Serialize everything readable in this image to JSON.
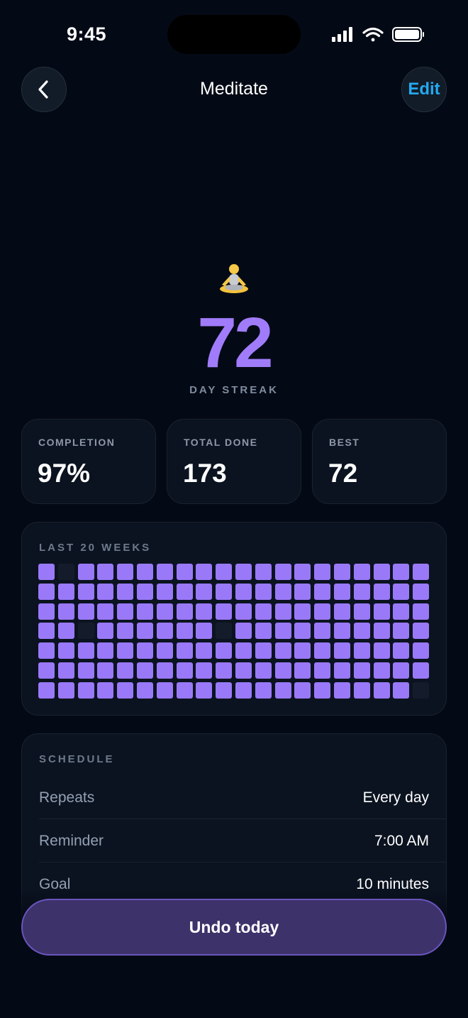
{
  "status_bar": {
    "time": "9:45"
  },
  "header": {
    "title": "Meditate",
    "edit_label": "Edit"
  },
  "habit": {
    "emoji": "person-in-lotus-position",
    "streak_value": "72",
    "streak_label": "DAY STREAK"
  },
  "stats": [
    {
      "label": "COMPLETION",
      "value": "97%"
    },
    {
      "label": "TOTAL DONE",
      "value": "173"
    },
    {
      "label": "BEST",
      "value": "72"
    }
  ],
  "history": {
    "title": "LAST 20 WEEKS",
    "done_color": "#9a79f9",
    "missed_color": "#141c2c",
    "missed_cells": [
      [
        0,
        1
      ],
      [
        3,
        2
      ],
      [
        3,
        9
      ],
      [
        6,
        19
      ]
    ],
    "rows": 7,
    "cols": 20
  },
  "schedule": {
    "title": "SCHEDULE",
    "rows": [
      {
        "label": "Repeats",
        "value": "Every day"
      },
      {
        "label": "Reminder",
        "value": "7:00 AM"
      },
      {
        "label": "Goal",
        "value": "10 minutes"
      }
    ]
  },
  "action": {
    "undo_label": "Undo today"
  },
  "colors": {
    "accent": "#a07cfb",
    "edit": "#23aaf0",
    "background": "#040a15"
  }
}
